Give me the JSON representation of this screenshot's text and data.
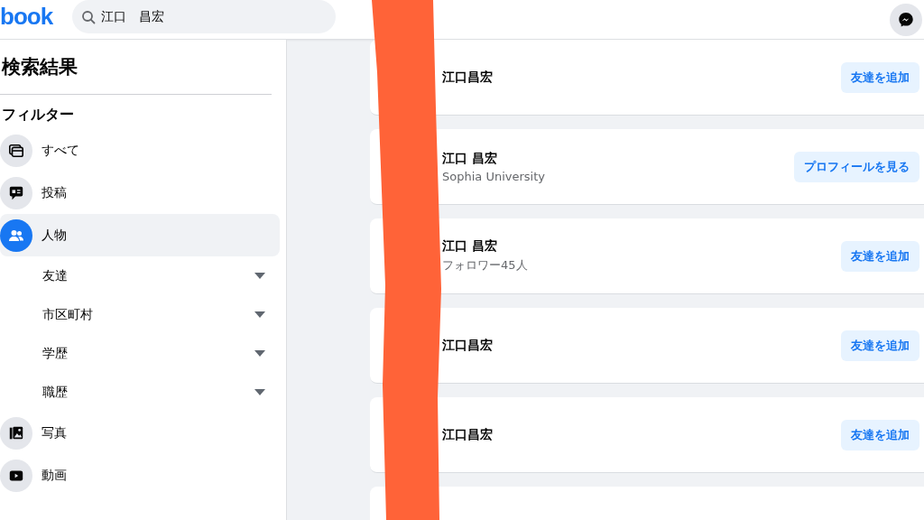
{
  "header": {
    "logo": "book",
    "search": {
      "value": "江口　昌宏"
    }
  },
  "sidebar": {
    "title": "検索結果",
    "filter_heading": "フィルター",
    "items": [
      {
        "label": "すべて",
        "kind": "category",
        "selected": false
      },
      {
        "label": "投稿",
        "kind": "category",
        "selected": false
      },
      {
        "label": "人物",
        "kind": "category",
        "selected": true
      },
      {
        "label": "友達",
        "kind": "subfilter"
      },
      {
        "label": "市区町村",
        "kind": "subfilter"
      },
      {
        "label": "学歴",
        "kind": "subfilter"
      },
      {
        "label": "職歴",
        "kind": "subfilter"
      },
      {
        "label": "写真",
        "kind": "category",
        "selected": false
      },
      {
        "label": "動画",
        "kind": "category",
        "selected": false
      }
    ]
  },
  "results": [
    {
      "name": "江口昌宏",
      "action": "友達を追加"
    },
    {
      "name": "江口 昌宏",
      "detail": "Sophia University",
      "action": "プロフィールを見る"
    },
    {
      "name": "江口 昌宏",
      "detail": "フォロワー45人",
      "action": "友達を追加"
    },
    {
      "name": "江口昌宏",
      "action": "友達を追加"
    },
    {
      "name": "江口昌宏",
      "action": "友達を追加"
    }
  ]
}
